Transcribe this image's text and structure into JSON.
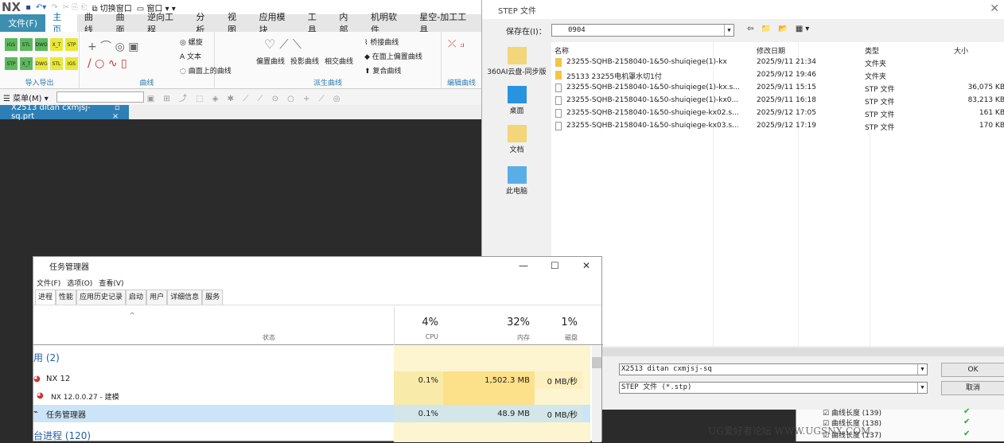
{
  "nx": {
    "logo": "NX",
    "quick_access": {
      "switch_window": "切换窗口",
      "window": "窗口"
    },
    "tabs": [
      "文件(F)",
      "主页",
      "曲线",
      "曲面",
      "逆向工程",
      "分析",
      "视图",
      "应用模块",
      "工具",
      "内部",
      "机明软件",
      "星空-加工工具"
    ],
    "ribbon": {
      "import_export": {
        "label": "导入导出",
        "row1": [
          "IGS",
          "STL",
          "DWG",
          "X_T",
          "STP"
        ],
        "row2": [
          "STP",
          "X_T",
          "DWG",
          "STL",
          "IGS"
        ]
      },
      "curve": {
        "label": "曲线",
        "items": [
          "螺旋",
          "文本",
          "曲面上的曲线"
        ]
      },
      "derived": {
        "label": "派生曲线",
        "big": [
          "偏置曲线",
          "投影曲线",
          "相交曲线"
        ],
        "items": [
          "桥接曲线",
          "在面上偏置曲线",
          "复合曲线"
        ]
      },
      "edit": {
        "label": "编辑曲线"
      }
    },
    "menu_button": "菜单(M)",
    "doc_tab": "X2513 ditan cxmjsj-sq.prt"
  },
  "step_dialog": {
    "title": "STEP 文件",
    "save_in_label": "保存在(I)：",
    "save_in_value": "0904",
    "places": [
      "360AI云盘-同步版",
      "桌面",
      "文档",
      "此电脑"
    ],
    "columns": [
      "名称",
      "修改日期",
      "类型",
      "大小"
    ],
    "files": [
      {
        "name": "23255-SQHB-2158040-1&50-shuiqiege(1)-kx",
        "date": "2025/9/11 21:34",
        "type": "文件夹",
        "size": "",
        "folder": true
      },
      {
        "name": "25133 23255电机罩水切1付",
        "date": "2025/9/12 19:46",
        "type": "文件夹",
        "size": "",
        "folder": true
      },
      {
        "name": "23255-SQHB-2158040-1&50-shuiqiege(1)-kx.s...",
        "date": "2025/9/11 15:15",
        "type": "STP 文件",
        "size": "36,075 KB",
        "folder": false
      },
      {
        "name": "23255-SQHB-2158040-1&50-shuiqiege(1)-kx0...",
        "date": "2025/9/11 16:18",
        "type": "STP 文件",
        "size": "83,213 KB",
        "folder": false
      },
      {
        "name": "23255-SQHB-2158040-1&50-shuiqiege-kx02.s...",
        "date": "2025/9/12 17:05",
        "type": "STP 文件",
        "size": "161 KB",
        "folder": false
      },
      {
        "name": "23255-SQHB-2158040-1&50-shuiqiege-kx03.s...",
        "date": "2025/9/12 17:19",
        "type": "STP 文件",
        "size": "170 KB",
        "folder": false
      }
    ],
    "filename": "X2513 ditan cxmjsj-sq",
    "filetype": "STEP 文件 (*.stp)",
    "ok": "OK",
    "cancel": "取消"
  },
  "task_manager": {
    "title": "任务管理器",
    "menu": [
      "文件(F)",
      "选项(O)",
      "查看(V)"
    ],
    "tabs": [
      "进程",
      "性能",
      "应用历史记录",
      "启动",
      "用户",
      "详细信息",
      "服务"
    ],
    "status_header": "状态",
    "cpu": {
      "pct": "4%",
      "label": "CPU"
    },
    "mem": {
      "pct": "32%",
      "label": "内存"
    },
    "disk": {
      "pct": "1%",
      "label": "磁盘"
    },
    "apps_group": "用 (2)",
    "rows": [
      {
        "name": "NX 12",
        "cpu": "0.1%",
        "mem": "1,502.3 MB",
        "disk": "0 MB/秒"
      },
      {
        "name": "NX 12.0.0.27 - 建模",
        "cpu": "",
        "mem": "",
        "disk": ""
      },
      {
        "name": "任务管理器",
        "cpu": "0.1%",
        "mem": "48.9 MB",
        "disk": "0 MB/秒"
      }
    ],
    "bg_group": "台进程 (120)"
  },
  "tree": {
    "items": [
      "曲线长度 (139)",
      "曲线长度 (138)",
      "曲线长度 (137)"
    ]
  },
  "watermark": "UG爱好者论坛 WWW.UGSNX.COM"
}
